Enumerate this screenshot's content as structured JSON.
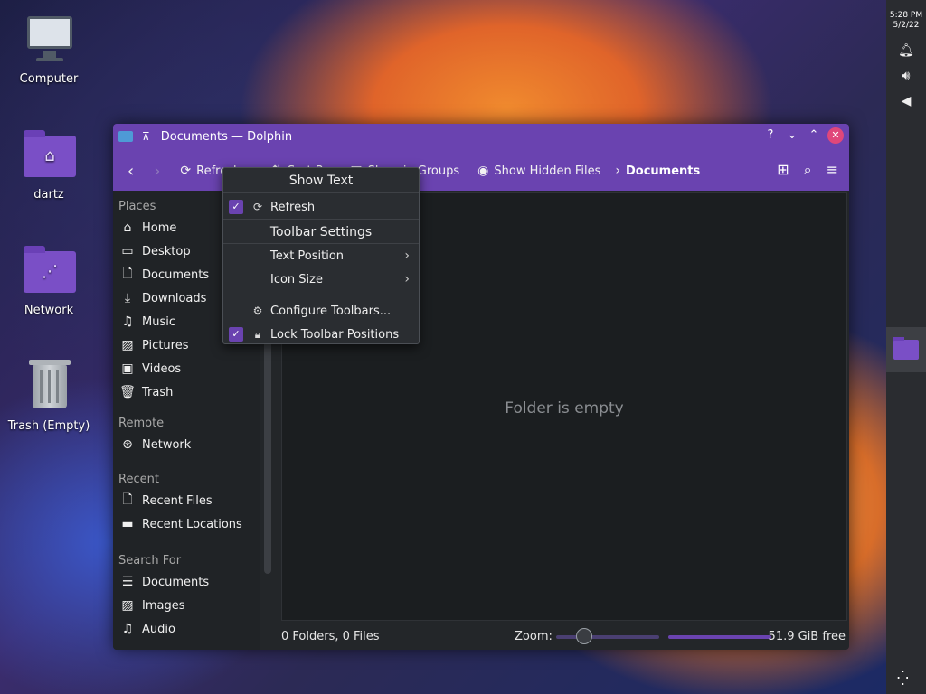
{
  "desktop": {
    "icons": [
      {
        "label": "Computer"
      },
      {
        "label": "dartz"
      },
      {
        "label": "Network"
      },
      {
        "label": "Trash (Empty)"
      }
    ]
  },
  "panel": {
    "time": "5:28 PM",
    "date": "5/2/22"
  },
  "window": {
    "title": "Documents — Dolphin",
    "toolbar": {
      "refresh_label": "Refresh",
      "sort_label": "Sort By",
      "groups_label": "Show in Groups",
      "hidden_label": "Show Hidden Files",
      "crumb": "Documents"
    },
    "sidebar": {
      "places_header": "Places",
      "places": [
        "Home",
        "Desktop",
        "Documents",
        "Downloads",
        "Music",
        "Pictures",
        "Videos",
        "Trash"
      ],
      "remote_header": "Remote",
      "remote": [
        "Network"
      ],
      "recent_header": "Recent",
      "recent": [
        "Recent Files",
        "Recent Locations"
      ],
      "search_header": "Search For",
      "search": [
        "Documents",
        "Images",
        "Audio"
      ]
    },
    "content": {
      "empty_text": "Folder is empty"
    },
    "status": {
      "summary": "0 Folders, 0 Files",
      "zoom_label": "Zoom:",
      "free": "51.9 GiB free"
    }
  },
  "context_menu": {
    "show_text": "Show Text",
    "refresh": "Refresh",
    "toolbar_settings": "Toolbar Settings",
    "text_position": "Text Position",
    "icon_size": "Icon Size",
    "configure": "Configure Toolbars...",
    "lock": "Lock Toolbar Positions"
  }
}
